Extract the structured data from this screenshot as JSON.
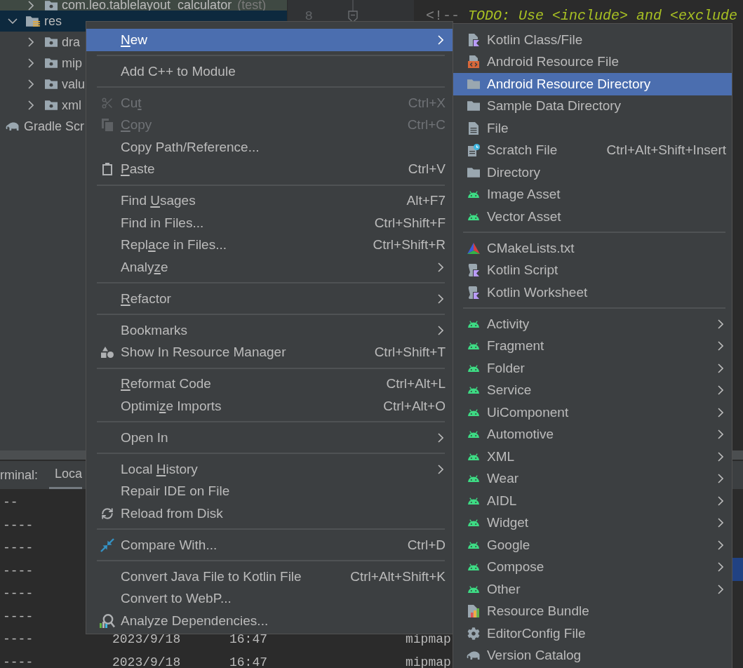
{
  "project_tree": {
    "nodes": [
      {
        "children": [
          {
            "children": [
              {
                "kind": "folder",
                "label": "com.leo.tablelayout_calculator",
                "suffix": "(test)",
                "color": "#3f4943",
                "expanded": false,
                "selected": false
              }
            ]
          },
          {
            "kind": "resources",
            "label": "res",
            "expanded": true,
            "selected": true,
            "children": [
              {
                "kind": "folder",
                "label": "dra",
                "expanded": false,
                "selected": false
              },
              {
                "kind": "folder",
                "label": "mip",
                "expanded": false,
                "selected": false
              },
              {
                "kind": "folder",
                "label": "valu",
                "expanded": false,
                "selected": false
              },
              {
                "kind": "folder",
                "label": "xml",
                "expanded": false,
                "selected": false
              }
            ]
          }
        ]
      },
      {
        "kind": "gradle",
        "label": "Gradle Scr",
        "selected": false
      }
    ]
  },
  "editor": {
    "line_number": "8",
    "code": "<!-- *TODO: Use <include> and <exclude*"
  },
  "terminal": {
    "label": "rminal:",
    "tabs": [
      {
        "label": "Loca",
        "selected": true
      }
    ],
    "lines": [
      {
        "cells": [
          "--"
        ]
      },
      {
        "cells": [
          "----"
        ]
      },
      {
        "cells": [
          "----"
        ]
      },
      {
        "cells": [
          "----"
        ]
      },
      {
        "cells": [
          "----"
        ]
      },
      {
        "cells": [
          "----"
        ]
      },
      {
        "cells": [
          "----",
          "2023/9/18",
          "16:47",
          "mipmap"
        ]
      },
      {
        "cells": [
          "----",
          "2023/9/18",
          "16:47",
          "mipmap"
        ]
      }
    ]
  },
  "context_menu": {
    "groups": [
      {
        "items": [
          {
            "kind": "plain",
            "label": [
              {
                "text": "N",
                "underline": true
              },
              {
                "text": "ew",
                "underline": false
              }
            ],
            "has_submenu": true,
            "selected": true,
            "disabled": false
          }
        ]
      },
      {
        "items": [
          {
            "kind": "plain",
            "label": "Add C++ to Module",
            "has_submenu": false,
            "selected": false,
            "disabled": false
          }
        ]
      },
      {
        "items": [
          {
            "kind": "cut",
            "label": [
              {
                "text": "Cu",
                "underline": false
              },
              {
                "text": "t",
                "underline": true
              }
            ],
            "shortcut": "Ctrl+X",
            "has_submenu": false,
            "selected": false,
            "disabled": true
          },
          {
            "kind": "copy",
            "label": [
              {
                "text": "C",
                "underline": true
              },
              {
                "text": "opy",
                "underline": false
              }
            ],
            "shortcut": "Ctrl+C",
            "has_submenu": false,
            "selected": false,
            "disabled": true
          },
          {
            "kind": "plain",
            "label": "Copy Path/Reference...",
            "has_submenu": false,
            "selected": false,
            "disabled": false
          },
          {
            "kind": "paste",
            "label": [
              {
                "text": "P",
                "underline": true
              },
              {
                "text": "aste",
                "underline": false
              }
            ],
            "shortcut": "Ctrl+V",
            "has_submenu": false,
            "selected": false,
            "disabled": false
          }
        ]
      },
      {
        "items": [
          {
            "kind": "plain",
            "label": [
              {
                "text": "Find ",
                "underline": false
              },
              {
                "text": "U",
                "underline": true
              },
              {
                "text": "sages",
                "underline": false
              }
            ],
            "shortcut": "Alt+F7",
            "has_submenu": false,
            "selected": false,
            "disabled": false
          },
          {
            "kind": "plain",
            "label": "Find in Files...",
            "shortcut": "Ctrl+Shift+F",
            "has_submenu": false,
            "selected": false,
            "disabled": false
          },
          {
            "kind": "plain",
            "label": [
              {
                "text": "Repl",
                "underline": false
              },
              {
                "text": "a",
                "underline": true
              },
              {
                "text": "ce in Files...",
                "underline": false
              }
            ],
            "shortcut": "Ctrl+Shift+R",
            "has_submenu": false,
            "selected": false,
            "disabled": false
          },
          {
            "kind": "plain",
            "label": [
              {
                "text": "Analy",
                "underline": false
              },
              {
                "text": "z",
                "underline": true
              },
              {
                "text": "e",
                "underline": false
              }
            ],
            "has_submenu": true,
            "selected": false,
            "disabled": false
          }
        ]
      },
      {
        "items": [
          {
            "kind": "plain",
            "label": [
              {
                "text": "R",
                "underline": true
              },
              {
                "text": "efactor",
                "underline": false
              }
            ],
            "has_submenu": true,
            "selected": false,
            "disabled": false
          }
        ]
      },
      {
        "items": [
          {
            "kind": "plain",
            "label": "Bookmarks",
            "has_submenu": true,
            "selected": false,
            "disabled": false
          },
          {
            "kind": "resources",
            "label": "Show In Resource Manager",
            "shortcut": "Ctrl+Shift+T",
            "has_submenu": false,
            "selected": false,
            "disabled": false
          }
        ]
      },
      {
        "items": [
          {
            "kind": "plain",
            "label": [
              {
                "text": "R",
                "underline": true
              },
              {
                "text": "eformat Code",
                "underline": false
              }
            ],
            "shortcut": "Ctrl+Alt+L",
            "has_submenu": false,
            "selected": false,
            "disabled": false
          },
          {
            "kind": "plain",
            "label": [
              {
                "text": "Optimi",
                "underline": false
              },
              {
                "text": "z",
                "underline": true
              },
              {
                "text": "e Imports",
                "underline": false
              }
            ],
            "shortcut": "Ctrl+Alt+O",
            "has_submenu": false,
            "selected": false,
            "disabled": false
          }
        ]
      },
      {
        "items": [
          {
            "kind": "plain",
            "label": "Open In",
            "has_submenu": true,
            "selected": false,
            "disabled": false
          }
        ]
      },
      {
        "items": [
          {
            "kind": "plain",
            "label": [
              {
                "text": "Local ",
                "underline": false
              },
              {
                "text": "H",
                "underline": true
              },
              {
                "text": "istory",
                "underline": false
              }
            ],
            "has_submenu": true,
            "selected": false,
            "disabled": false
          },
          {
            "kind": "plain",
            "label": "Repair IDE on File",
            "has_submenu": false,
            "selected": false,
            "disabled": false
          },
          {
            "kind": "reload",
            "label": "Reload from Disk",
            "has_submenu": false,
            "selected": false,
            "disabled": false
          }
        ]
      },
      {
        "items": [
          {
            "kind": "compare",
            "label": "Compare With...",
            "shortcut": "Ctrl+D",
            "has_submenu": false,
            "selected": false,
            "disabled": false
          }
        ]
      },
      {
        "items": [
          {
            "kind": "plain",
            "label": "Convert Java File to Kotlin File",
            "shortcut": "Ctrl+Alt+Shift+K",
            "has_submenu": false,
            "selected": false,
            "disabled": false
          },
          {
            "kind": "plain",
            "label": "Convert to WebP...",
            "has_submenu": false,
            "selected": false,
            "disabled": false
          },
          {
            "kind": "dependencies",
            "label": "Analyze Dependencies...",
            "has_submenu": false,
            "selected": false,
            "disabled": false
          }
        ]
      }
    ]
  },
  "submenu": {
    "groups": [
      {
        "items": [
          {
            "kind": "kotlin",
            "label": "Kotlin Class/File",
            "has_submenu": false,
            "selected": false
          },
          {
            "kind": "resfile",
            "label": "Android Resource File",
            "has_submenu": false,
            "selected": false
          },
          {
            "kind": "directory",
            "label": "Android Resource Directory",
            "has_submenu": false,
            "selected": true
          },
          {
            "kind": "directory",
            "label": "Sample Data Directory",
            "has_submenu": false,
            "selected": false
          },
          {
            "kind": "file",
            "label": "File",
            "has_submenu": false,
            "selected": false
          },
          {
            "kind": "scratch",
            "label": "Scratch File",
            "shortcut": "Ctrl+Alt+Shift+Insert",
            "has_submenu": false,
            "selected": false
          },
          {
            "kind": "directory",
            "label": "Directory",
            "has_submenu": false,
            "selected": false
          },
          {
            "kind": "android",
            "label": "Image Asset",
            "has_submenu": false,
            "selected": false
          },
          {
            "kind": "android",
            "label": "Vector Asset",
            "has_submenu": false,
            "selected": false
          }
        ]
      },
      {
        "items": [
          {
            "kind": "cmake",
            "label": "CMakeLists.txt",
            "has_submenu": false,
            "selected": false
          },
          {
            "kind": "kts",
            "label": "Kotlin Script",
            "has_submenu": false,
            "selected": false
          },
          {
            "kind": "kts",
            "label": "Kotlin Worksheet",
            "has_submenu": false,
            "selected": false
          }
        ]
      },
      {
        "items": [
          {
            "kind": "android",
            "label": "Activity",
            "has_submenu": true,
            "selected": false
          },
          {
            "kind": "android",
            "label": "Fragment",
            "has_submenu": true,
            "selected": false
          },
          {
            "kind": "android",
            "label": "Folder",
            "has_submenu": true,
            "selected": false
          },
          {
            "kind": "android",
            "label": "Service",
            "has_submenu": true,
            "selected": false
          },
          {
            "kind": "android",
            "label": "UiComponent",
            "has_submenu": true,
            "selected": false
          },
          {
            "kind": "android",
            "label": "Automotive",
            "has_submenu": true,
            "selected": false
          },
          {
            "kind": "android",
            "label": "XML",
            "has_submenu": true,
            "selected": false
          },
          {
            "kind": "android",
            "label": "Wear",
            "has_submenu": true,
            "selected": false
          },
          {
            "kind": "android",
            "label": "AIDL",
            "has_submenu": true,
            "selected": false
          },
          {
            "kind": "android",
            "label": "Widget",
            "has_submenu": true,
            "selected": false
          },
          {
            "kind": "android",
            "label": "Google",
            "has_submenu": true,
            "selected": false
          },
          {
            "kind": "android",
            "label": "Compose",
            "has_submenu": true,
            "selected": false
          },
          {
            "kind": "android",
            "label": "Other",
            "has_submenu": true,
            "selected": false
          },
          {
            "kind": "bundle",
            "label": "Resource Bundle",
            "has_submenu": false,
            "selected": false
          },
          {
            "kind": "editorconfig",
            "label": "EditorConfig File",
            "has_submenu": false,
            "selected": false
          },
          {
            "kind": "catalog",
            "label": "Version Catalog",
            "has_submenu": false,
            "selected": false
          }
        ]
      }
    ]
  }
}
